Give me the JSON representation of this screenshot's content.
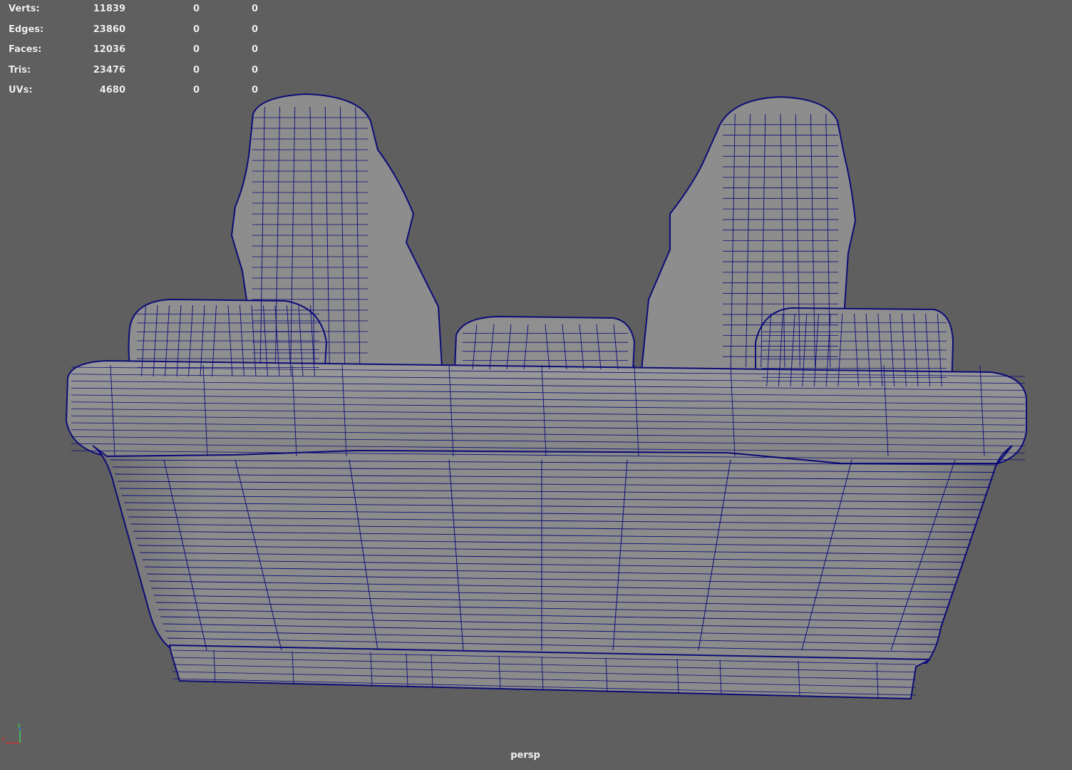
{
  "viewport": {
    "camera": "persp",
    "background_color": "#5f5f5f",
    "wire_color": "#0c0c78",
    "shade_color": "#8f8f8f"
  },
  "heads_up_display": {
    "rows": [
      {
        "label": "Verts:",
        "values": [
          "11839",
          "0",
          "0"
        ]
      },
      {
        "label": "Edges:",
        "values": [
          "23860",
          "0",
          "0"
        ]
      },
      {
        "label": "Faces:",
        "values": [
          "12036",
          "0",
          "0"
        ]
      },
      {
        "label": "Tris:",
        "values": [
          "23476",
          "0",
          "0"
        ]
      },
      {
        "label": "UVs:",
        "values": [
          "4680",
          "0",
          "0"
        ]
      }
    ]
  },
  "axis_gizmo": {
    "x_label": "x",
    "y_label": "y",
    "x_color": "#d03030",
    "y_color": "#40d040",
    "z_color": "#3060ff"
  },
  "model": {
    "name": "sofa-wireframe"
  }
}
